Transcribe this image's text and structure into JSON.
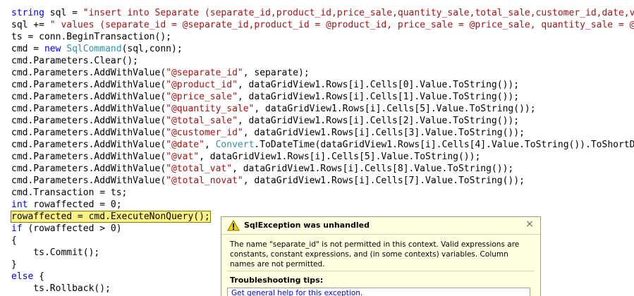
{
  "code_lines": [
    [
      {
        "t": "string",
        "c": "kw"
      },
      {
        "t": " sql = "
      },
      {
        "t": "\"insert into Separate (separate_id,product_id,price_sale,quantity_sale,total_sale,customer_id,date,vat,total_vat,total_novat)\"",
        "c": "str"
      }
    ],
    [
      {
        "t": "sql += "
      },
      {
        "t": "\" values (separate_id = @separate_id,product_id = @product_id, price_sale = @price_sale, quantity_sale = @quantity_sale\"",
        "c": "str"
      }
    ],
    [
      {
        "t": "ts = conn.BeginTransaction();"
      }
    ],
    [
      {
        "t": "cmd = "
      },
      {
        "t": "new",
        "c": "kw"
      },
      {
        "t": " "
      },
      {
        "t": "SqlCommand",
        "c": "type"
      },
      {
        "t": "(sql,conn);"
      }
    ],
    [
      {
        "t": "cmd.Parameters.Clear();"
      }
    ],
    [
      {
        "t": "cmd.Parameters.AddWithValue("
      },
      {
        "t": "\"@separate_id\"",
        "c": "str"
      },
      {
        "t": ", separate);"
      }
    ],
    [
      {
        "t": "cmd.Parameters.AddWithValue("
      },
      {
        "t": "\"@product_id\"",
        "c": "str"
      },
      {
        "t": ", dataGridView1.Rows[i].Cells[0].Value.ToString());"
      }
    ],
    [
      {
        "t": "cmd.Parameters.AddWithValue("
      },
      {
        "t": "\"@price_sale\"",
        "c": "str"
      },
      {
        "t": ", dataGridView1.Rows[i].Cells[1].Value.ToString());"
      }
    ],
    [
      {
        "t": "cmd.Parameters.AddWithValue("
      },
      {
        "t": "\"@quantity_sale\"",
        "c": "str"
      },
      {
        "t": ", dataGridView1.Rows[i].Cells[5].Value.ToString());"
      }
    ],
    [
      {
        "t": "cmd.Parameters.AddWithValue("
      },
      {
        "t": "\"@total_sale\"",
        "c": "str"
      },
      {
        "t": ", dataGridView1.Rows[i].Cells[2].Value.ToString());"
      }
    ],
    [
      {
        "t": "cmd.Parameters.AddWithValue("
      },
      {
        "t": "\"@customer_id\"",
        "c": "str"
      },
      {
        "t": ", dataGridView1.Rows[i].Cells[3].Value.ToString());"
      }
    ],
    [
      {
        "t": "cmd.Parameters.AddWithValue("
      },
      {
        "t": "\"@date\"",
        "c": "str"
      },
      {
        "t": ", "
      },
      {
        "t": "Convert",
        "c": "type"
      },
      {
        "t": ".ToDateTime(dataGridView1.Rows[i].Cells[4].Value.ToString()).ToShortDateString());"
      }
    ],
    [
      {
        "t": "cmd.Parameters.AddWithValue("
      },
      {
        "t": "\"@vat\"",
        "c": "str"
      },
      {
        "t": ", dataGridView1.Rows[i].Cells[5].Value.ToString());"
      }
    ],
    [
      {
        "t": "cmd.Parameters.AddWithValue("
      },
      {
        "t": "\"@total_vat\"",
        "c": "str"
      },
      {
        "t": ", dataGridView1.Rows[i].Cells[8].Value.ToString());"
      }
    ],
    [
      {
        "t": "cmd.Parameters.AddWithValue("
      },
      {
        "t": "\"@total_novat\"",
        "c": "str"
      },
      {
        "t": ", dataGridView1.Rows[i].Cells[7].Value.ToString());"
      }
    ],
    [
      {
        "t": "cmd.Transaction = ts;"
      }
    ],
    [
      {
        "t": "int",
        "c": "kw"
      },
      {
        "t": " rowaffected = 0;"
      }
    ],
    [
      {
        "t": "rowaffected = cmd.ExecuteNonQuery();",
        "c": "hl"
      }
    ],
    [
      {
        "t": "if",
        "c": "kw"
      },
      {
        "t": " (rowaffected > 0)"
      }
    ],
    [
      {
        "t": "{"
      }
    ],
    [
      {
        "t": "    ts.Commit();"
      }
    ],
    [
      {
        "t": "}"
      }
    ],
    [
      {
        "t": "else",
        "c": "kw"
      },
      {
        "t": " {"
      }
    ],
    [
      {
        "t": "    ts.Rollback();"
      }
    ]
  ],
  "exception": {
    "title": "SqlException was unhandled",
    "message": "The name \"separate_id\" is not permitted in this context. Valid expressions are constants, constant expressions, and (in some contexts) variables. Column names are not permitted.",
    "tips_heading": "Troubleshooting tips:",
    "tip_link": "Get general help for this exception.",
    "close_glyph": "×",
    "icon": "warning-icon"
  },
  "colors": {
    "keyword": "#0000ff",
    "type": "#2b91af",
    "string": "#a31515",
    "highlight": "#fff386",
    "popup_background": "#ffffe1"
  }
}
